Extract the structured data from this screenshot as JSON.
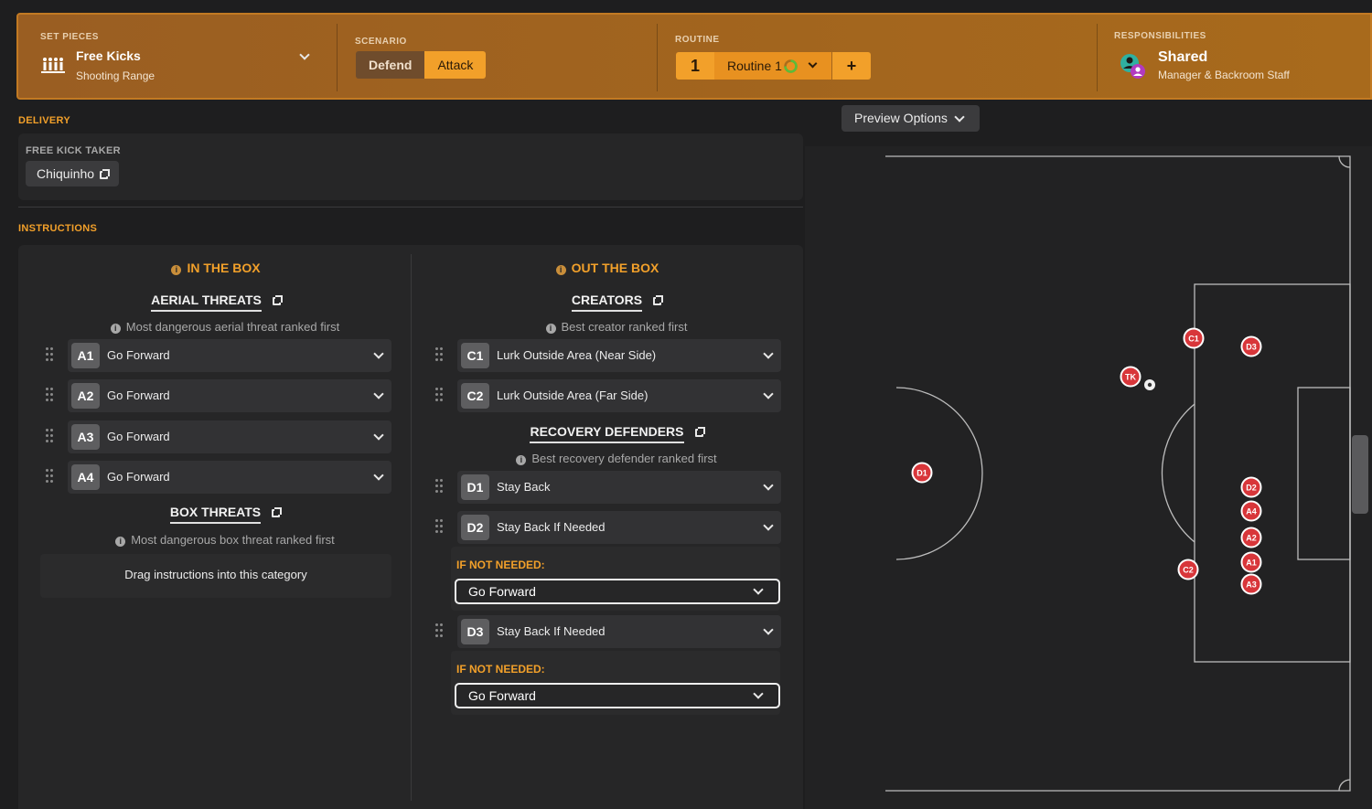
{
  "topbar": {
    "set_pieces": {
      "label": "SET PIECES",
      "title": "Free Kicks",
      "subtitle": "Shooting Range",
      "icon": "wall-icon"
    },
    "scenario": {
      "label": "SCENARIO",
      "options": [
        "Defend",
        "Attack"
      ],
      "selected": "Attack"
    },
    "routine": {
      "label": "ROUTINE",
      "number": "1",
      "name": "Routine 1",
      "add": "+"
    },
    "responsibilities": {
      "label": "RESPONSIBILITIES",
      "title": "Shared",
      "subtitle": "Manager & Backroom Staff",
      "icon": "staff-icon"
    }
  },
  "delivery": {
    "label": "DELIVERY",
    "taker_label": "FREE KICK TAKER",
    "taker_name": "Chiquinho"
  },
  "instructions": {
    "label": "INSTRUCTIONS",
    "in_box": {
      "heading": "IN THE BOX",
      "aerial": {
        "title": "AERIAL THREATS",
        "hint": "Most dangerous aerial threat ranked first",
        "rows": [
          {
            "badge": "A1",
            "text": "Go Forward"
          },
          {
            "badge": "A2",
            "text": "Go Forward"
          },
          {
            "badge": "A3",
            "text": "Go Forward"
          },
          {
            "badge": "A4",
            "text": "Go Forward"
          }
        ]
      },
      "box": {
        "title": "BOX THREATS",
        "hint": "Most dangerous box threat ranked first",
        "empty": "Drag instructions into this category"
      }
    },
    "out_box": {
      "heading": "OUT THE BOX",
      "creators": {
        "title": "CREATORS",
        "hint": "Best creator ranked first",
        "rows": [
          {
            "badge": "C1",
            "text": "Lurk Outside Area (Near Side)"
          },
          {
            "badge": "C2",
            "text": "Lurk Outside Area (Far Side)"
          }
        ]
      },
      "recovery": {
        "title": "RECOVERY DEFENDERS",
        "hint": "Best recovery defender ranked first",
        "rows": [
          {
            "badge": "D1",
            "text": "Stay Back"
          },
          {
            "badge": "D2",
            "text": "Stay Back If Needed"
          },
          {
            "badge": "D3",
            "text": "Stay Back If Needed"
          }
        ],
        "if_not_label": "IF NOT NEEDED:",
        "if_not_value_1": "Go Forward",
        "if_not_value_2": "Go Forward"
      }
    }
  },
  "preview": {
    "label": "Preview Options"
  },
  "pitch": {
    "markers": [
      "C1",
      "D3",
      "TK",
      "D1",
      "D2",
      "A4",
      "A2",
      "A1",
      "A3",
      "C2"
    ],
    "marker_color": "#d8363a"
  }
}
